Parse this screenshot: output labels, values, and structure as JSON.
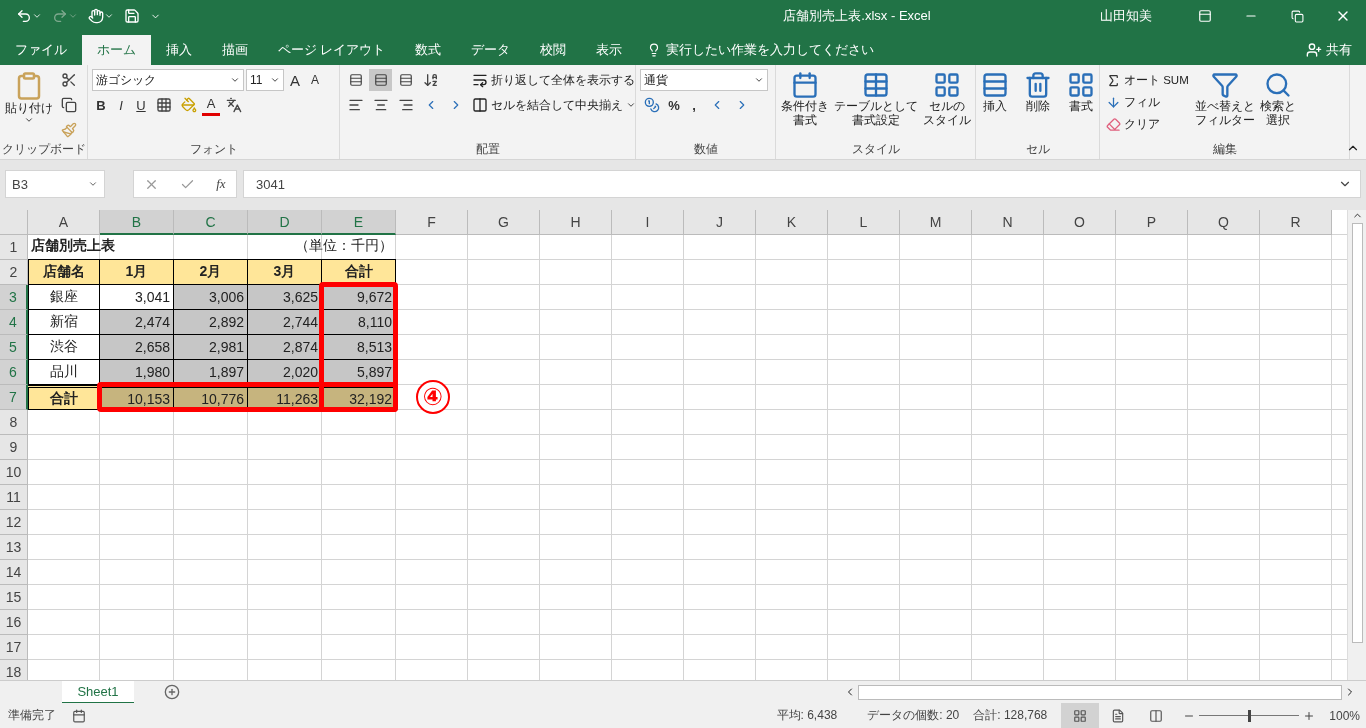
{
  "title_bar": {
    "title": "店舗別売上表.xlsx  -  Excel",
    "user": "山田知美"
  },
  "tabs": [
    {
      "label": "ファイル",
      "selected": false
    },
    {
      "label": "ホーム",
      "selected": true
    },
    {
      "label": "挿入",
      "selected": false
    },
    {
      "label": "描画",
      "selected": false
    },
    {
      "label": "ページ レイアウト",
      "selected": false
    },
    {
      "label": "数式",
      "selected": false
    },
    {
      "label": "データ",
      "selected": false
    },
    {
      "label": "校閲",
      "selected": false
    },
    {
      "label": "表示",
      "selected": false
    }
  ],
  "tell_me": "実行したい作業を入力してください",
  "share": "共有",
  "ribbon": [
    {
      "kind": "clipboard",
      "name": "クリップボード",
      "paste": "貼り付け"
    },
    {
      "kind": "font",
      "name": "フォント",
      "font_name": "游ゴシック",
      "font_size": "11",
      "grow": "A",
      "shrink": "A",
      "bold": "B",
      "italic": "I",
      "underline": "U",
      "font_color": "A"
    },
    {
      "kind": "alignment",
      "name": "配置",
      "wrap": "折り返して全体を表示する",
      "merge": "セルを結合して中央揃え",
      "vertical_buttons": [
        {
          "selected": false
        },
        {
          "selected": true
        },
        {
          "selected": false
        }
      ]
    },
    {
      "kind": "number",
      "name": "数値",
      "format": "通貨",
      "percent": "%",
      "comma": ","
    },
    {
      "kind": "styles",
      "name": "スタイル",
      "items": [
        {
          "lines": [
            "条件付き",
            "書式"
          ]
        },
        {
          "lines": [
            "テーブルとして",
            "書式設定"
          ]
        },
        {
          "lines": [
            "セルの",
            "スタイル"
          ]
        }
      ]
    },
    {
      "kind": "cells",
      "name": "セル",
      "items": [
        {
          "label": "挿入"
        },
        {
          "label": "削除"
        },
        {
          "label": "書式"
        }
      ]
    },
    {
      "kind": "editing",
      "name": "編集",
      "small": [
        "オート SUM",
        "フィル",
        "クリア"
      ],
      "large": [
        {
          "lines": [
            "並べ替えと",
            "フィルター"
          ]
        },
        {
          "lines": [
            "検索と",
            "選択"
          ]
        }
      ]
    }
  ],
  "formula_bar": {
    "name_box": "B3",
    "fx": "fx",
    "formula": "3041"
  },
  "columns": [
    {
      "label": "A",
      "selected": false
    },
    {
      "label": "B",
      "selected": true
    },
    {
      "label": "C",
      "selected": true
    },
    {
      "label": "D",
      "selected": true
    },
    {
      "label": "E",
      "selected": true
    },
    {
      "label": "F",
      "selected": false
    },
    {
      "label": "G",
      "selected": false
    },
    {
      "label": "H",
      "selected": false
    },
    {
      "label": "I",
      "selected": false
    },
    {
      "label": "J",
      "selected": false
    },
    {
      "label": "K",
      "selected": false
    },
    {
      "label": "L",
      "selected": false
    },
    {
      "label": "M",
      "selected": false
    },
    {
      "label": "N",
      "selected": false
    },
    {
      "label": "O",
      "selected": false
    },
    {
      "label": "P",
      "selected": false
    },
    {
      "label": "Q",
      "selected": false
    },
    {
      "label": "R",
      "selected": false
    }
  ],
  "rows": [
    {
      "label": "1",
      "selected": false,
      "kind": "title",
      "cells": [
        {
          "text": "店舗別売上表"
        },
        {},
        {},
        {},
        {
          "text": "（単位：千円）"
        }
      ]
    },
    {
      "label": "2",
      "selected": false,
      "kind": "header",
      "cells": [
        {
          "text": "店舗名"
        },
        {
          "text": "1月"
        },
        {
          "text": "2月"
        },
        {
          "text": "3月"
        },
        {
          "text": "合計"
        }
      ]
    },
    {
      "label": "3",
      "selected": true,
      "kind": "body",
      "cells": [
        {
          "text": "銀座"
        },
        {
          "text": "3,041"
        },
        {
          "text": "3,006"
        },
        {
          "text": "3,625"
        },
        {
          "text": "9,672"
        }
      ]
    },
    {
      "label": "4",
      "selected": true,
      "kind": "body",
      "cells": [
        {
          "text": "新宿"
        },
        {
          "text": "2,474"
        },
        {
          "text": "2,892"
        },
        {
          "text": "2,744"
        },
        {
          "text": "8,110"
        }
      ]
    },
    {
      "label": "5",
      "selected": true,
      "kind": "body",
      "cells": [
        {
          "text": "渋谷"
        },
        {
          "text": "2,658"
        },
        {
          "text": "2,981"
        },
        {
          "text": "2,874"
        },
        {
          "text": "8,513"
        }
      ]
    },
    {
      "label": "6",
      "selected": true,
      "kind": "body",
      "cells": [
        {
          "text": "品川"
        },
        {
          "text": "1,980"
        },
        {
          "text": "1,897"
        },
        {
          "text": "2,020"
        },
        {
          "text": "5,897"
        }
      ]
    },
    {
      "label": "7",
      "selected": true,
      "kind": "total",
      "cells": [
        {
          "text": "合計"
        },
        {
          "text": "10,153"
        },
        {
          "text": "10,776"
        },
        {
          "text": "11,263"
        },
        {
          "text": "32,192"
        }
      ]
    },
    {
      "label": "8",
      "selected": false
    },
    {
      "label": "9",
      "selected": false
    },
    {
      "label": "10",
      "selected": false
    },
    {
      "label": "11",
      "selected": false
    },
    {
      "label": "12",
      "selected": false
    },
    {
      "label": "13",
      "selected": false
    },
    {
      "label": "14",
      "selected": false
    },
    {
      "label": "15",
      "selected": false
    },
    {
      "label": "16",
      "selected": false
    },
    {
      "label": "17",
      "selected": false
    },
    {
      "label": "18",
      "selected": false
    }
  ],
  "annotation_frames": [
    {
      "kind": "total_column"
    },
    {
      "kind": "total_row"
    }
  ],
  "callout": "④",
  "sheets": [
    {
      "label": "Sheet1",
      "selected": true
    }
  ],
  "status_bar": {
    "ready": "準備完了",
    "average": "平均: 6,438",
    "count": "データの個数: 20",
    "sum": "合計: 128,768",
    "views": [
      {
        "selected": true
      },
      {
        "selected": false
      },
      {
        "selected": false
      }
    ],
    "zoom": {
      "level": 0.5,
      "reading": "100%"
    }
  }
}
